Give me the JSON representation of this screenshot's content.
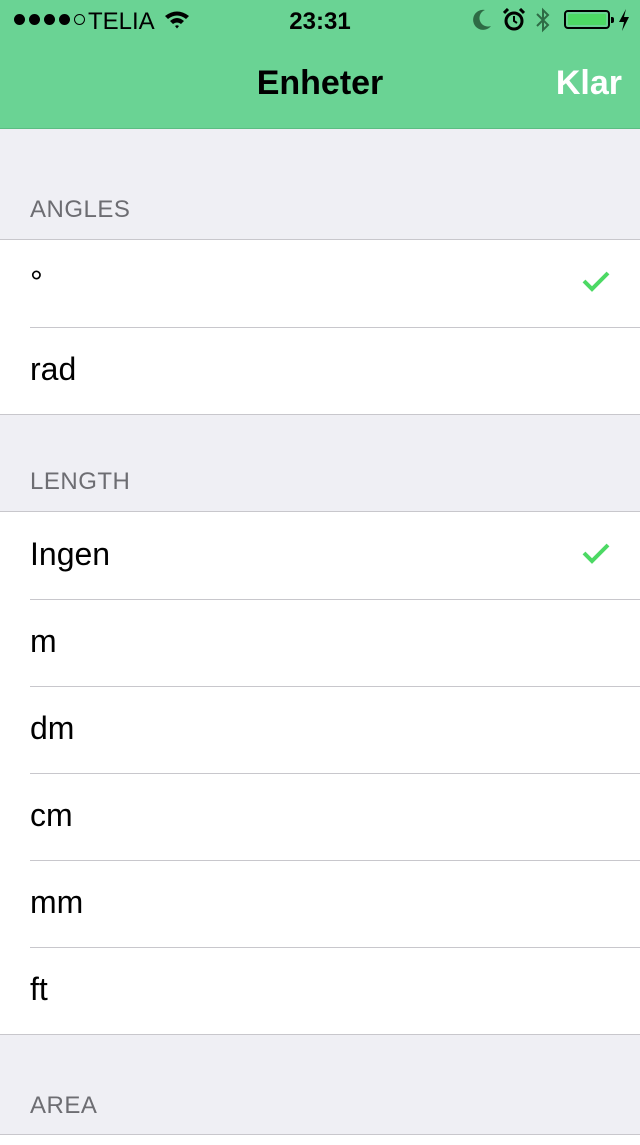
{
  "status_bar": {
    "signal_bars_filled": 4,
    "signal_bars_total": 5,
    "carrier": "TELIA",
    "time": "23:31",
    "battery_level": 1.0,
    "icons": [
      "wifi-icon",
      "moon-icon",
      "alarm-icon",
      "bluetooth-icon",
      "battery-icon",
      "charging-icon"
    ]
  },
  "nav": {
    "title": "Enheter",
    "done_label": "Klar"
  },
  "colors": {
    "nav_background": "#6ad394",
    "checkmark": "#4cd964",
    "page_background": "#efeff4"
  },
  "sections": [
    {
      "header": "ANGLES",
      "items": [
        {
          "label": "°",
          "selected": true
        },
        {
          "label": "rad",
          "selected": false
        }
      ]
    },
    {
      "header": "LENGTH",
      "items": [
        {
          "label": "Ingen",
          "selected": true
        },
        {
          "label": "m",
          "selected": false
        },
        {
          "label": "dm",
          "selected": false
        },
        {
          "label": "cm",
          "selected": false
        },
        {
          "label": "mm",
          "selected": false
        },
        {
          "label": "ft",
          "selected": false
        }
      ]
    },
    {
      "header": "AREA",
      "items": []
    }
  ]
}
